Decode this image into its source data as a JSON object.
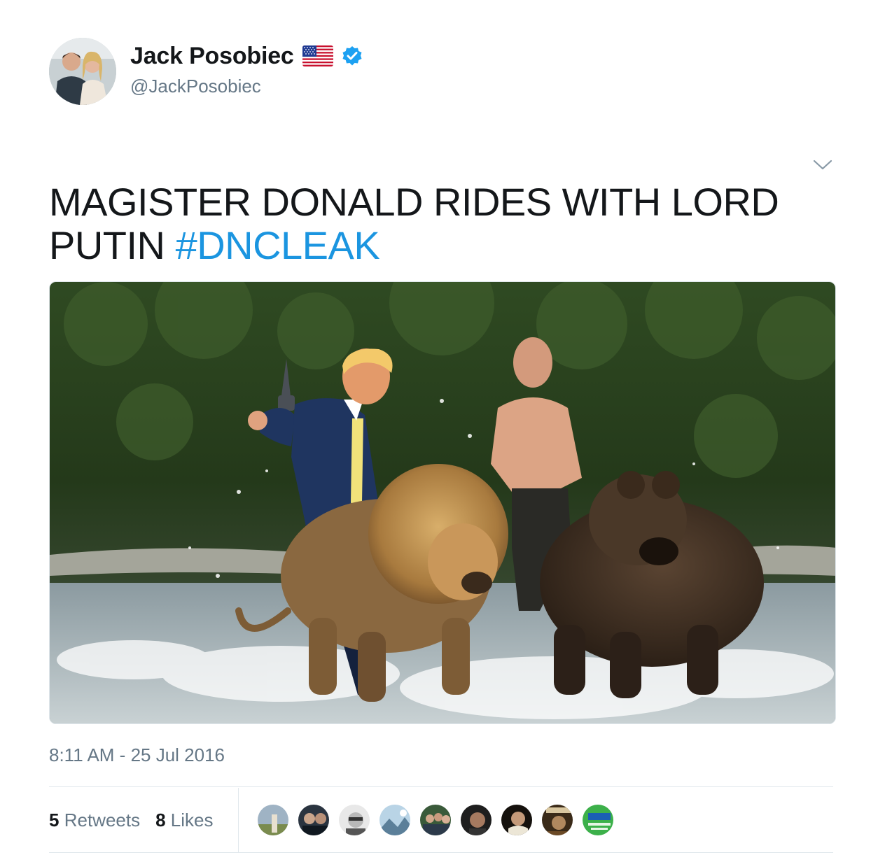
{
  "author": {
    "display_name": "Jack Posobiec",
    "handle": "@JackPosobiec",
    "flag_icon": "us-flag-icon",
    "verified_icon": "verified-badge-icon"
  },
  "menu": {
    "caret_icon": "chevron-down-icon"
  },
  "tweet": {
    "text": "MAGISTER DONALD RIDES WITH LORD PUTIN",
    "hashtag": "#DNCLEAK",
    "timestamp": "8:11 AM - 25 Jul 2016"
  },
  "stats": {
    "retweets_count": "5",
    "retweets_label": "Retweets",
    "likes_count": "8",
    "likes_label": "Likes"
  },
  "colors": {
    "link": "#1b95e0",
    "secondary_text": "#657786",
    "verified": "#1da1f2",
    "divider": "#e1e8ed"
  }
}
